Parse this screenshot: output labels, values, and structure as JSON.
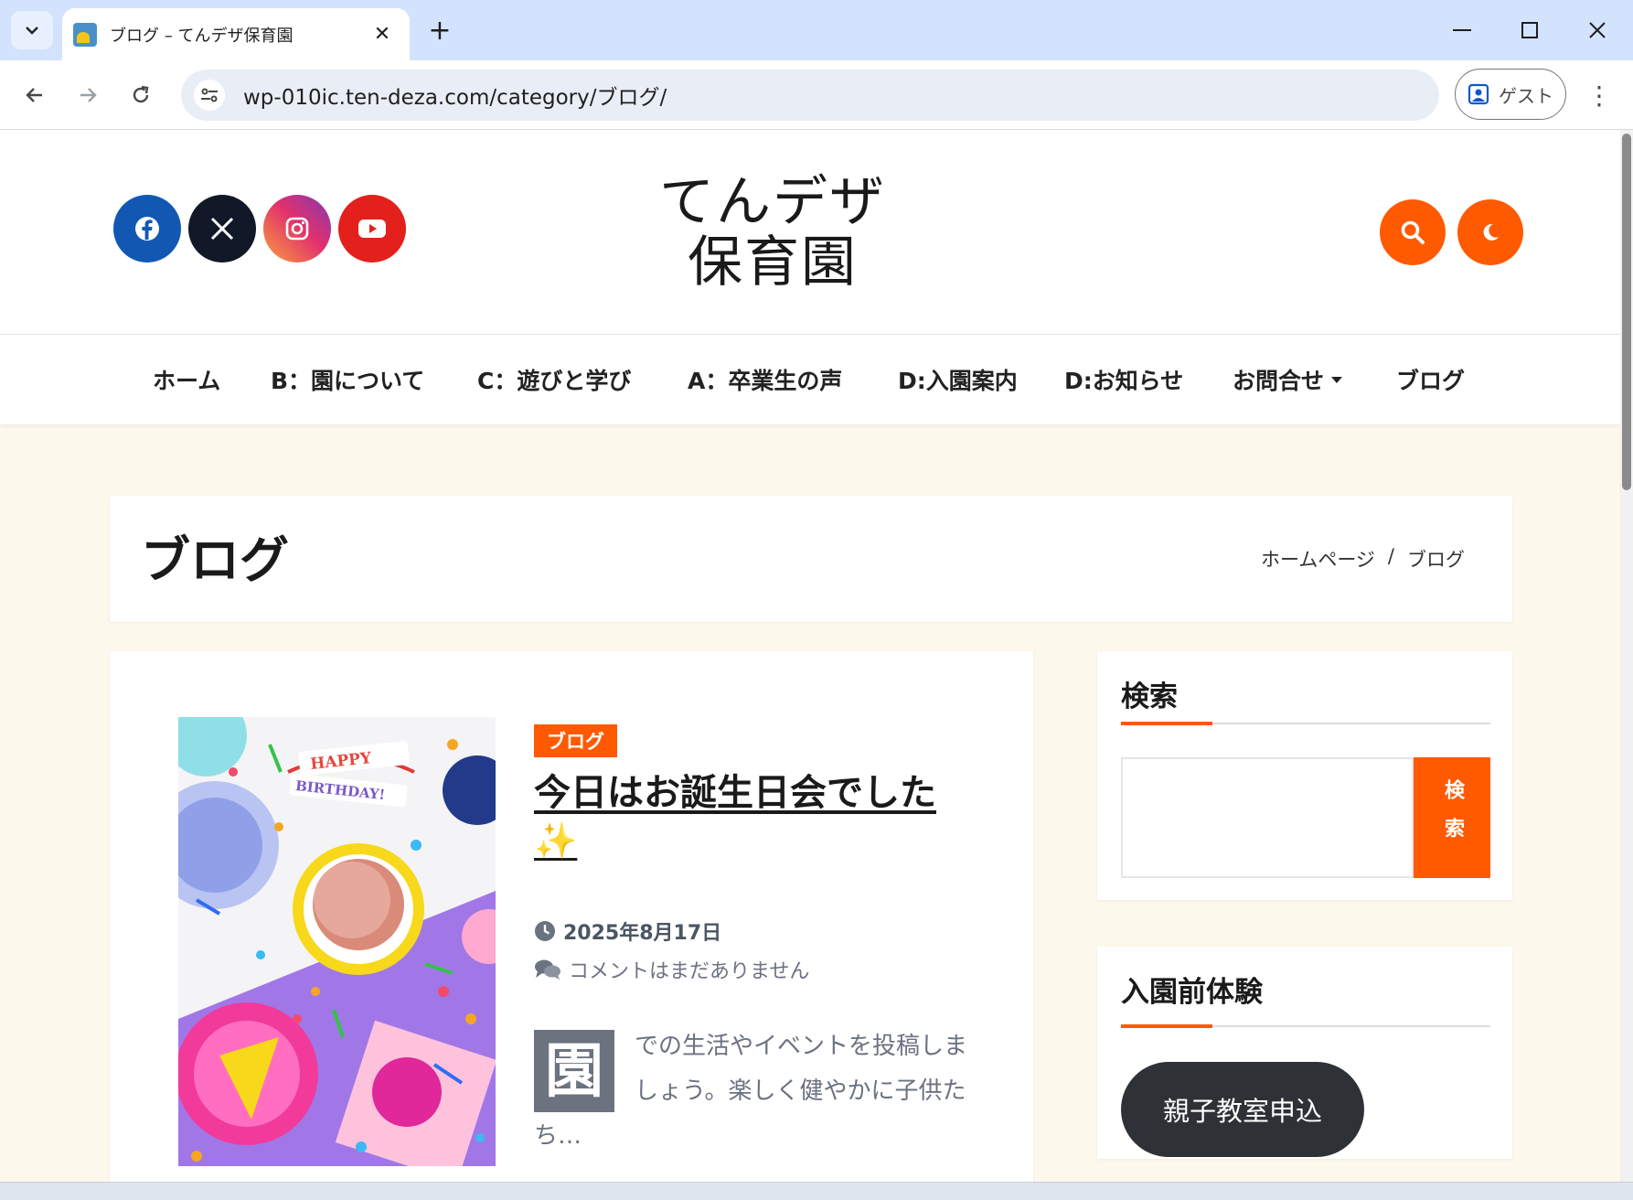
{
  "browser": {
    "tab_title": "ブログ – てんデザ保育園",
    "url": "wp-010ic.ten-deza.com/category/ブログ/",
    "guest_label": "ゲスト",
    "new_tab_symbol": "+",
    "close_symbol": "✕",
    "menu_symbol": "⋮"
  },
  "site": {
    "title_line1": "てんデザ",
    "title_line2": "保育園",
    "social": [
      {
        "name": "facebook",
        "color": "#1258b3"
      },
      {
        "name": "x",
        "color": "#111827"
      },
      {
        "name": "instagram",
        "color": "#e1306c"
      },
      {
        "name": "youtube",
        "color": "#e3201b"
      }
    ],
    "accent": "#ff5a00"
  },
  "nav": {
    "items": [
      "ホーム",
      "B：園について",
      "C：遊びと学び",
      "A：卒業生の声",
      "D:入園案内",
      "D:お知らせ",
      "お問合せ",
      "ブログ"
    ]
  },
  "page": {
    "heading": "ブログ",
    "breadcrumb_home": "ホームページ",
    "breadcrumb_sep": "/",
    "breadcrumb_current": "ブログ"
  },
  "post": {
    "category": "ブログ",
    "title": "今日はお誕生日会でした",
    "title_emoji": "✨",
    "date": "2025年8月17日",
    "comments": "コメントはまだありません",
    "dropcap": "園",
    "excerpt": "での生活やイベントを投稿しましょう。楽しく健やかに子供たち…",
    "image_banner_top": "HAPPY",
    "image_banner_bottom": "BIRTHDAY!"
  },
  "sidebar": {
    "search_title": "検索",
    "search_button": "検索",
    "trial_title": "入園前体験",
    "trial_button": "親子教室申込"
  }
}
